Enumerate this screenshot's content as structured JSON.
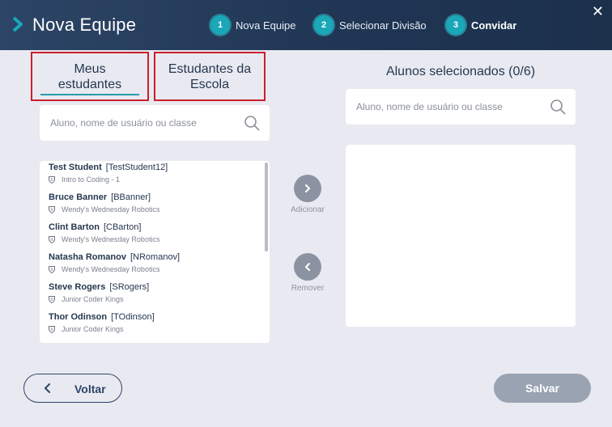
{
  "header": {
    "title": "Nova Equipe",
    "close_label": "✕",
    "steps": [
      {
        "num": "1",
        "label": "Nova Equipe"
      },
      {
        "num": "2",
        "label": "Selecionar Divisão"
      },
      {
        "num": "3",
        "label": "Convidar"
      }
    ],
    "active_step": "3"
  },
  "tabs": {
    "my_students": "Meus estudantes",
    "school_students": "Estudantes da Escola"
  },
  "left_search": {
    "placeholder": "Aluno, nome de usuário ou classe"
  },
  "students": [
    {
      "name": "Test Student",
      "username": "[TestStudent12]",
      "class": "Intro to Coding - 1"
    },
    {
      "name": "Bruce Banner",
      "username": "[BBanner]",
      "class": "Wendy's Wednesday Robotics"
    },
    {
      "name": "Clint Barton",
      "username": "[CBarton]",
      "class": "Wendy's Wednesday Robotics"
    },
    {
      "name": "Natasha Romanov",
      "username": "[NRomanov]",
      "class": "Wendy's Wednesday Robotics"
    },
    {
      "name": "Steve Rogers",
      "username": "[SRogers]",
      "class": "Junior Coder Kings"
    },
    {
      "name": "Thor Odinson",
      "username": "[TOdinson]",
      "class": "Junior Coder Kings"
    }
  ],
  "actions": {
    "add_label": "Adicionar",
    "remove_label": "Remover"
  },
  "selected": {
    "title": "Alunos selecionados (0/6)",
    "search_placeholder": "Aluno, nome de usuário ou classe"
  },
  "footer": {
    "back_label": "Voltar",
    "save_label": "Salvar"
  },
  "colors": {
    "header": "#1f3553",
    "accent": "#1aa7b8",
    "highlight_border": "#c8202b",
    "disabled_button": "#9aa3b2"
  }
}
